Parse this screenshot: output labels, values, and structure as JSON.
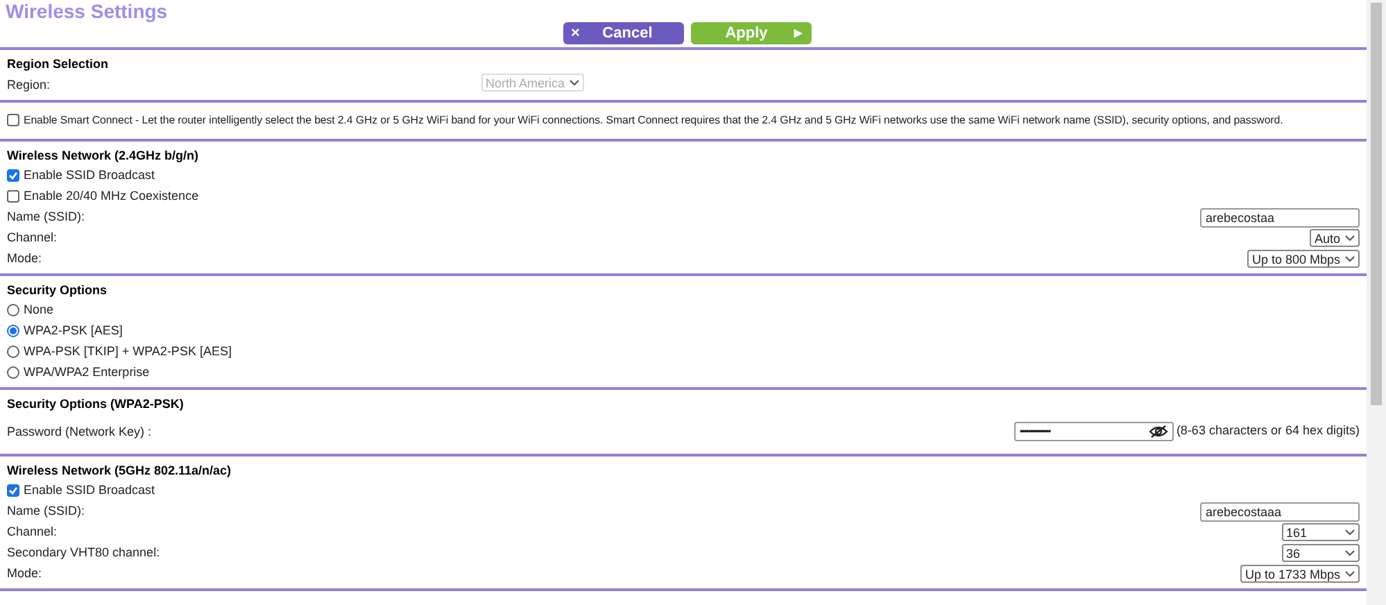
{
  "title": "Wireless Settings",
  "buttons": [
    {
      "kind": "cancel",
      "icon": "×",
      "label": "Cancel"
    },
    {
      "kind": "apply",
      "icon": "▸",
      "label": "Apply"
    }
  ],
  "sections": [
    {
      "heading": "Region Selection",
      "rows": [
        {
          "kind": "select_inline",
          "label": "Region:",
          "value": "North America",
          "disabled": true
        }
      ]
    },
    {
      "rows": [
        {
          "kind": "checkbox",
          "label": "Enable Smart Connect - Let the router intelligently select the best 2.4 GHz or 5 GHz WiFi band for your WiFi connections. Smart Connect requires that the 2.4 GHz and 5 GHz WiFi networks use the same WiFi network name (SSID), security options, and password.",
          "checked": false
        }
      ]
    },
    {
      "heading": "Wireless Network (2.4GHz b/g/n)",
      "rows": [
        {
          "kind": "checkbox",
          "label": "Enable SSID Broadcast",
          "checked": true
        },
        {
          "kind": "checkbox",
          "label": "Enable 20/40 MHz Coexistence",
          "checked": false
        },
        {
          "kind": "text",
          "label": "Name (SSID):",
          "value": "arebecostaa"
        },
        {
          "kind": "select",
          "label": "Channel:",
          "value": "Auto",
          "disabled": false
        },
        {
          "kind": "select",
          "label": "Mode:",
          "value": "Up to 800 Mbps",
          "disabled": false
        }
      ]
    },
    {
      "heading": "Security Options",
      "rows": [
        {
          "kind": "radio",
          "label": "None",
          "selected": false
        },
        {
          "kind": "radio",
          "label": "WPA2-PSK [AES]",
          "selected": true
        },
        {
          "kind": "radio",
          "label": "WPA-PSK [TKIP] + WPA2-PSK [AES]",
          "selected": false
        },
        {
          "kind": "radio",
          "label": "WPA/WPA2 Enterprise",
          "selected": false
        }
      ]
    },
    {
      "heading": "Security Options (WPA2-PSK)",
      "rows": [
        {
          "kind": "password",
          "label": "Password (Network Key) :",
          "value": "•••••••••••••••",
          "hint": "(8-63 characters or 64 hex digits)"
        }
      ]
    },
    {
      "heading": "Wireless Network (5GHz 802.11a/n/ac)",
      "rows": [
        {
          "kind": "checkbox",
          "label": "Enable SSID Broadcast",
          "checked": true
        },
        {
          "kind": "text",
          "label": "Name (SSID):",
          "value": "arebecostaaa"
        },
        {
          "kind": "select_wide",
          "label": "Channel:",
          "value": "161",
          "disabled": false
        },
        {
          "kind": "select_wide",
          "label": "Secondary VHT80 channel:",
          "value": "36",
          "disabled": false
        },
        {
          "kind": "select",
          "label": "Mode:",
          "value": "Up to 1733 Mbps",
          "disabled": false
        }
      ]
    }
  ]
}
